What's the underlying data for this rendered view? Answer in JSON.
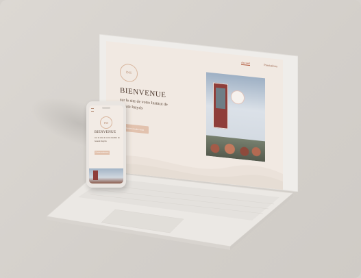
{
  "laptop_site": {
    "nav": [
      "Accueil",
      "Prestations"
    ],
    "logo_text": "INS",
    "title": "BIENVENUE",
    "subtitle": "sur le site de votre Institut de beauté Insyris",
    "button_label": "Prendre rendez-vous"
  },
  "phone_site": {
    "logo_text": "INS",
    "title": "BIENVENUE",
    "subtitle": "sur le site de votre institut de beauté Insyris",
    "button_label": "Prendre rendez-vous"
  },
  "colors": {
    "background": "#d6d2cd",
    "site_background": "#f1e9e2",
    "accent": "#e2c2ae",
    "title_text": "#4f3b30"
  }
}
